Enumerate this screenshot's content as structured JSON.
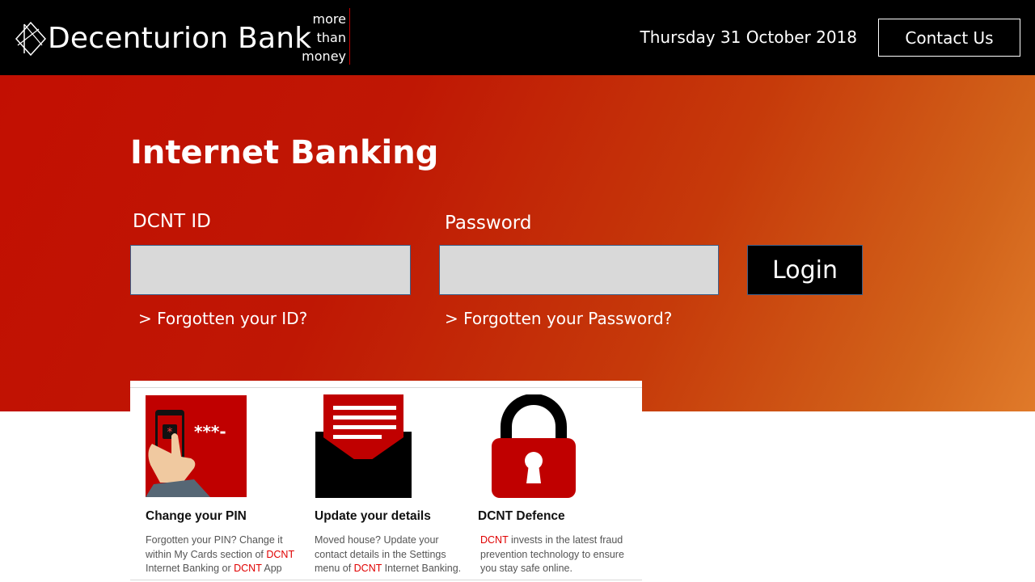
{
  "header": {
    "brand": "Decenturion Bank",
    "tagline": [
      "more",
      "than",
      "money"
    ],
    "date": "Thursday 31 October 2018",
    "contact_label": "Contact Us"
  },
  "login": {
    "title": "Internet Banking",
    "id_label": "DCNT ID",
    "id_value": "",
    "password_label": "Password",
    "password_value": "",
    "login_label": "Login",
    "forgot_id": "> Forgotten your ID?",
    "forgot_password": "> Forgotten your Password?"
  },
  "promos": [
    {
      "title": "Change your PIN",
      "desc": {
        "l1": "Forgotten your PIN? Change it",
        "l2a": "within My Cards section of ",
        "l2b": "DCNT",
        "l3a": "Internet Banking or ",
        "l3b": "DCNT",
        "l3c": " App"
      }
    },
    {
      "title": "Update your details",
      "desc": {
        "l1": "Moved house? Update your",
        "l2": "contact details in the Settings",
        "l3a": "menu of ",
        "l3b": "DCNT",
        "l3c": " Internet Banking."
      }
    },
    {
      "title_a": "DCNT",
      "title_b": " Defence",
      "desc": {
        "l1a": "DCNT",
        "l1b": " invests in the latest fraud",
        "l2": "prevention technology to ensure",
        "l3": "you stay safe online."
      }
    }
  ],
  "colors": {
    "header_bg": "#000000",
    "hero_red": "#c20f02",
    "hero_orange": "#e07a2a",
    "promo_red": "#c00000",
    "link_red": "#e00000"
  }
}
